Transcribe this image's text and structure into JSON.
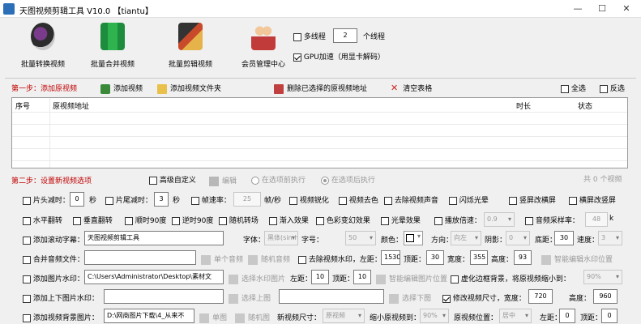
{
  "window": {
    "title": "天图视频剪辑工具 V10.0 【tiantu】",
    "minimize": "—",
    "maximize": "☐",
    "close": "✕"
  },
  "toolbar": {
    "tools": [
      {
        "label": "批量转换视频",
        "icon": "film-reel-icon"
      },
      {
        "label": "批量合并视频",
        "icon": "merge-film-icon"
      },
      {
        "label": "批量剪辑视频",
        "icon": "scissors-film-icon"
      },
      {
        "label": "会员管理中心",
        "icon": "users-icon"
      }
    ],
    "multithread_label": "多线程",
    "thread_count": "2",
    "thread_unit": "个线程",
    "gpu_label": "GPU加速（用显卡解码）"
  },
  "step1": {
    "title": "第一步：添加原视频",
    "add_video": "添加视频",
    "add_folder": "添加视频文件夹",
    "delete_selected": "删除已选择的原视频地址",
    "clear_table": "清空表格",
    "select_all": "全选",
    "invert": "反选"
  },
  "table": {
    "columns": [
      "序号",
      "原视频地址",
      "时长",
      "状态"
    ]
  },
  "step2": {
    "title": "第二步：设置新视频选项",
    "advanced": "高级自定义",
    "edit": "编辑",
    "exec_on_option": "在选项前执行",
    "exec_after_option": "在选项后执行",
    "count": "共 0 个视频"
  },
  "rows": {
    "r1": {
      "head_cut": "片头减时：",
      "head_val": "0",
      "sec1": "秒",
      "tail_cut": "片尾减时：",
      "tail_val": "3",
      "sec2": "秒",
      "fps": "帧速率：",
      "fps_val": "25",
      "fps_unit": "帧/秒",
      "sharpen": "视频锐化",
      "decolor": "视频去色",
      "remove_audio": "去除视频声音",
      "flash": "闪烁光晕",
      "vert_to_horiz": "竖屏改横屏",
      "horiz_to_vert": "横屏改竖屏"
    },
    "r2": {
      "hflip": "水平翻转",
      "vflip": "垂直翻转",
      "rot_cw": "顺时90度",
      "rot_ccw": "逆时90度",
      "random_transition": "随机转场",
      "fade_in": "渐入效果",
      "color_change": "色彩变幻效果",
      "light_effect": "光晕效果",
      "speed": "播放倍速：",
      "speed_val": "0.9",
      "sample_rate": "音频采样率：",
      "sample_val": "48",
      "sample_unit": "k"
    },
    "r3": {
      "scroll_caption": "添加滚动字幕：",
      "caption_text": "天图视频剪辑工具",
      "font": "字体：",
      "font_val": "黑体(simhei)",
      "size": "字号：",
      "size_val": "50",
      "color": "颜色：",
      "direction": "方向：",
      "direction_val": "向左",
      "shadow": "阴影：",
      "shadow_val": "0",
      "bottom": "底距：",
      "bottom_val": "30",
      "speed": "速度：",
      "speed_val": "3"
    },
    "r4": {
      "merge_audio": "合并音频文件：",
      "single_audio": "单个音频",
      "random_audio": "随机音频",
      "remove_watermark": "去除视频水印，左距：",
      "left_val": "1530",
      "top": "顶距：",
      "top_val": "30",
      "width": "宽度：",
      "width_val": "355",
      "height": "高度：",
      "height_val": "93",
      "smart_pos": "智能编辑水印位置"
    },
    "r5": {
      "pic_watermark": "添加图片水印：",
      "path": "C:\\Users\\Administrator\\Desktop\\素材文",
      "select_pic": "选择水印图片",
      "left": "左距：",
      "left_val": "10",
      "top": "顶距：",
      "top_val": "10",
      "smart_pos": "智能编辑图片位置",
      "virtual_bg": "虚化边框背景，将原视频缩小到：",
      "scale_val": "90%"
    },
    "r6": {
      "top_bottom_pic": "添加上下图片水印：",
      "select_top": "选择上图",
      "select_bottom": "选择下图",
      "modify_size": "修改视频尺寸，宽度：",
      "width_val": "720",
      "height": "高度：",
      "height_val": "960"
    },
    "r7": {
      "bg_pic": "添加视频背景图片：",
      "path": "D:\\网商图片下载\\4_从来不",
      "single": "单图",
      "random": "随机图",
      "new_size": "新视频尺寸：",
      "new_size_val": "原视频",
      "scale_to": "缩小原视频到：",
      "scale_val": "90%",
      "pos": "原视频位置：",
      "pos_val": "居中",
      "left": "左距：",
      "left_val": "0",
      "top": "顶距：",
      "top_val": "0"
    }
  }
}
